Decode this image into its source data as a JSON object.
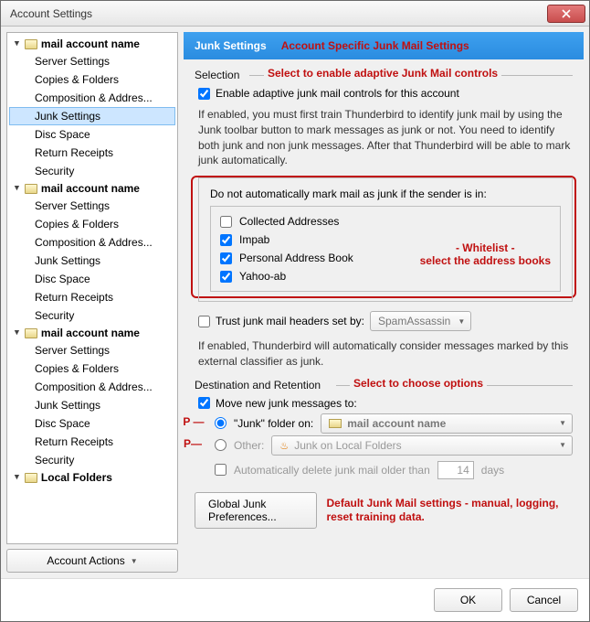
{
  "window_title": "Account Settings",
  "sidebar": {
    "accounts": [
      {
        "label": "mail account name",
        "items": [
          "Server Settings",
          "Copies & Folders",
          "Composition & Addres...",
          "Junk Settings",
          "Disc Space",
          "Return Receipts",
          "Security"
        ],
        "selected": "Junk Settings"
      },
      {
        "label": "mail account name",
        "items": [
          "Server Settings",
          "Copies & Folders",
          "Composition & Addres...",
          "Junk Settings",
          "Disc Space",
          "Return Receipts",
          "Security"
        ]
      },
      {
        "label": "mail account name",
        "items": [
          "Server Settings",
          "Copies & Folders",
          "Composition & Addres...",
          "Junk Settings",
          "Disc Space",
          "Return Receipts",
          "Security"
        ]
      },
      {
        "label": "Local Folders",
        "items": []
      }
    ],
    "account_actions": "Account Actions"
  },
  "header": "Junk Settings",
  "selection_section": {
    "label": "Selection",
    "enable_label": "Enable adaptive junk mail controls for this account",
    "enable_checked": true,
    "description": "If enabled, you must first train Thunderbird to identify junk mail by using the Junk toolbar button to mark messages as junk or not. You need to identify both junk and non junk messages. After that Thunderbird will be able to mark junk automatically.",
    "whitelist_label": "Do not automatically mark mail as junk if the sender is in:",
    "whitelist_books": [
      {
        "label": "Collected Addresses",
        "checked": false
      },
      {
        "label": "Impab",
        "checked": true
      },
      {
        "label": "Personal Address Book",
        "checked": true
      },
      {
        "label": "Yahoo-ab",
        "checked": true
      }
    ],
    "trust_headers_label": "Trust junk mail headers set by:",
    "trust_headers_checked": false,
    "trust_headers_value": "SpamAssassin",
    "trust_desc": "If enabled, Thunderbird will automatically consider messages marked by this external classifier as junk."
  },
  "dest_section": {
    "label": "Destination and Retention",
    "move_label": "Move new junk messages to:",
    "move_checked": true,
    "junk_folder_label": "\"Junk\" folder on:",
    "junk_folder_value": "mail account name",
    "junk_folder_selected": true,
    "other_label": "Other:",
    "other_value": "Junk on Local Folders",
    "auto_delete_label": "Automatically delete junk mail older than",
    "auto_delete_checked": false,
    "auto_delete_days": "14",
    "auto_delete_suffix": "days"
  },
  "global_prefs": "Global Junk Preferences...",
  "footer": {
    "ok": "OK",
    "cancel": "Cancel"
  },
  "annotations": {
    "header": "Account Specific Junk Mail Settings",
    "selection": "Select to enable adaptive Junk Mail controls",
    "whitelist_title": "- Whitelist -",
    "whitelist_sub": "select the address books",
    "dest": "Select to choose options",
    "pop": "POP",
    "imap": "IMAP",
    "global": "Default Junk Mail settings - manual, logging, reset training data."
  }
}
